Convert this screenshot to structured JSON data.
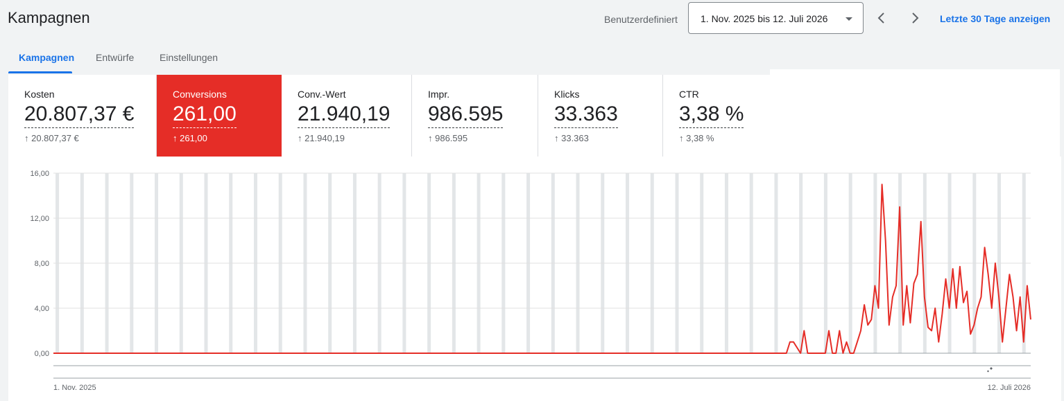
{
  "header": {
    "title": "Kampagnen",
    "date_range_label": "Benutzerdefiniert",
    "date_range_value": "1. Nov. 2025 bis 12. Juli 2026",
    "last_30_link": "Letzte 30 Tage anzeigen",
    "prev_icon": "chevron-left-icon",
    "next_icon": "chevron-right-icon"
  },
  "tabs": [
    {
      "label": "Kampagnen",
      "active": true
    },
    {
      "label": "Entwürfe",
      "active": false
    },
    {
      "label": "Einstellungen",
      "active": false
    }
  ],
  "metrics": [
    {
      "label": "Kosten",
      "value": "20.807,37 €",
      "change": "↑ 20.807,37 €",
      "selected": false
    },
    {
      "label": "Conversions",
      "value": "261,00",
      "change": "↑ 261,00",
      "selected": true
    },
    {
      "label": "Conv.-Wert",
      "value": "21.940,19",
      "change": "↑ 21.940,19",
      "selected": false
    },
    {
      "label": "Impr.",
      "value": "986.595",
      "change": "↑ 986.595",
      "selected": false
    },
    {
      "label": "Klicks",
      "value": "33.363",
      "change": "↑ 33.363",
      "selected": false
    },
    {
      "label": "CTR",
      "value": "3,38 %",
      "change": "↑ 3,38 %",
      "selected": false
    }
  ],
  "colors": {
    "accent": "#1a73e8",
    "selected_metric": "#e52d27",
    "line": "#e52d27",
    "weekend_band": "#e3e6e8"
  },
  "chart_data": {
    "type": "line",
    "x_start_label": "1. Nov. 2025",
    "x_end_label": "12. Juli 2026",
    "yticks": [
      "0,00",
      "4,00",
      "8,00",
      "12,00",
      "16,00"
    ],
    "ylim": [
      0,
      16
    ],
    "grid": true,
    "series": [
      {
        "values": [
          0,
          0,
          0,
          0,
          0,
          0,
          0,
          0,
          0,
          0,
          0,
          0,
          0,
          0,
          0,
          0,
          0,
          0,
          0,
          0,
          0,
          0,
          0,
          0,
          0,
          0,
          0,
          0,
          0,
          0,
          0,
          0,
          0,
          0,
          0,
          0,
          0,
          0,
          0,
          0,
          0,
          0,
          0,
          0,
          0,
          0,
          0,
          0,
          0,
          0,
          0,
          0,
          0,
          0,
          0,
          0,
          0,
          0,
          0,
          0,
          0,
          0,
          0,
          0,
          0,
          0,
          0,
          0,
          0,
          0,
          0,
          0,
          0,
          0,
          0,
          0,
          0,
          0,
          0,
          0,
          0,
          0,
          0,
          0,
          0,
          0,
          0,
          0,
          0,
          0,
          0,
          0,
          0,
          0,
          0,
          0,
          0,
          0,
          0,
          0,
          0,
          0,
          0,
          0,
          0,
          0,
          0,
          0,
          0,
          0,
          0,
          0,
          0,
          0,
          0,
          0,
          0,
          0,
          0,
          0,
          0,
          0,
          0,
          0,
          0,
          0,
          0,
          0,
          0,
          0,
          0,
          0,
          0,
          0,
          0,
          0,
          0,
          0,
          0,
          0,
          0,
          0,
          0,
          0,
          0,
          0,
          0,
          0,
          0,
          0,
          0,
          0,
          0,
          0,
          0,
          0,
          0,
          0,
          0,
          0,
          0,
          0,
          0,
          0,
          0,
          0,
          0,
          0,
          0,
          0,
          0,
          0,
          0,
          0,
          0,
          0,
          0,
          0,
          0,
          0,
          0,
          0,
          0,
          0,
          0,
          0,
          0,
          0,
          0,
          0,
          0,
          0,
          0,
          0,
          0,
          0,
          0,
          0,
          0,
          0,
          0,
          0,
          0,
          0,
          0,
          0,
          0,
          0,
          1,
          1,
          0.5,
          0,
          2,
          0,
          0,
          0,
          0,
          0,
          0,
          2,
          0,
          0,
          2,
          0,
          1,
          0,
          0,
          1,
          2,
          4.3,
          2.5,
          3,
          6,
          4,
          15,
          10,
          2.5,
          5,
          6,
          13,
          2.5,
          6,
          2.7,
          6.2,
          7,
          11.7,
          5,
          2.3,
          2,
          4,
          1,
          3.5,
          6.6,
          4,
          7.5,
          4,
          7.7,
          4.5,
          5.5,
          1.7,
          2.5,
          4,
          5,
          9.4,
          7,
          4,
          8,
          5,
          1,
          4,
          7,
          5,
          2,
          5,
          1,
          6,
          3
        ]
      }
    ]
  }
}
